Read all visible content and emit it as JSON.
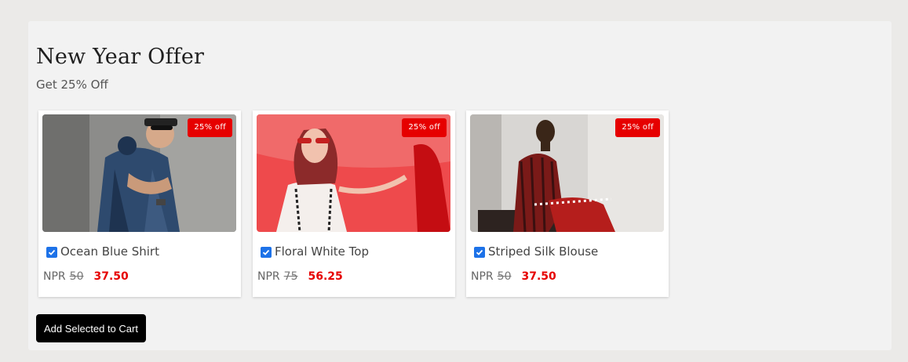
{
  "offer": {
    "title": "New Year Offer",
    "subtitle": "Get 25% Off"
  },
  "currency": "NPR",
  "products": [
    {
      "name": "Ocean Blue Shirt",
      "old_price": "50",
      "new_price": "37.50",
      "badge": "25% off",
      "selected": true
    },
    {
      "name": "Floral White Top",
      "old_price": "75",
      "new_price": "56.25",
      "badge": "25% off",
      "selected": true
    },
    {
      "name": "Striped Silk Blouse",
      "old_price": "50",
      "new_price": "37.50",
      "badge": "25% off",
      "selected": true
    }
  ],
  "actions": {
    "add_to_cart": "Add Selected to Cart"
  },
  "colors": {
    "accent_red": "#e60000",
    "checkbox_blue": "#1d72e8",
    "button_black": "#000000"
  }
}
